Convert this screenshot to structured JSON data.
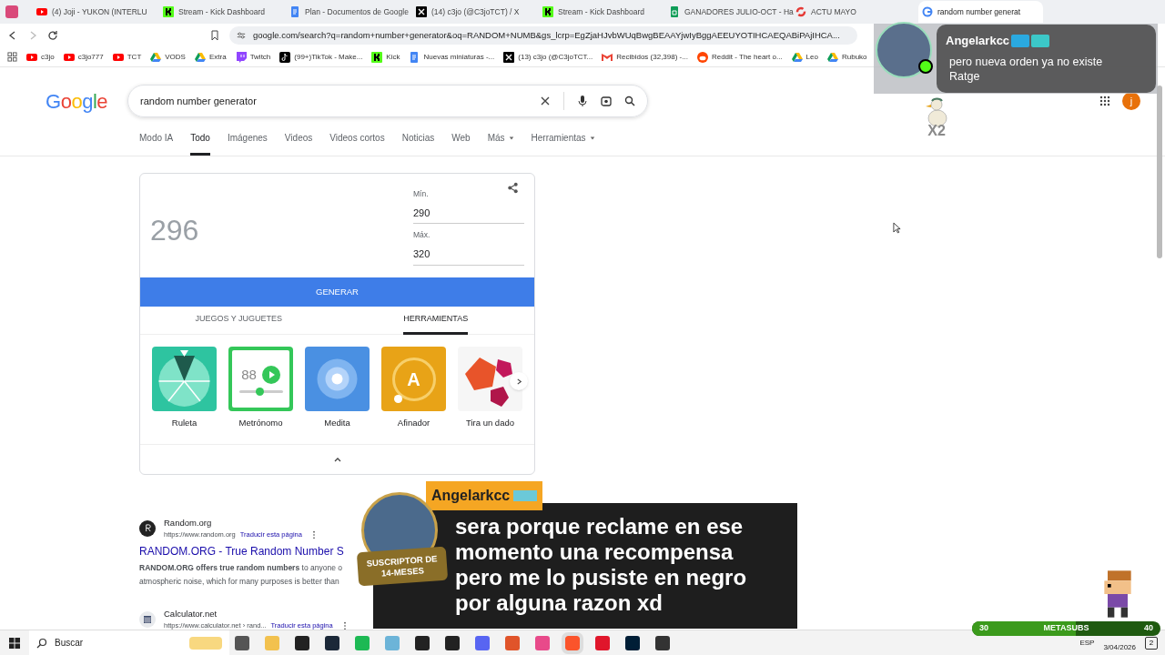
{
  "browser": {
    "tabs": [
      {
        "label": "(4) Joji - YUKON (INTERLU",
        "kind": "youtube",
        "selected": false
      },
      {
        "label": "Stream - Kick Dashboard",
        "kind": "kick",
        "selected": false
      },
      {
        "label": "Plan - Documentos de Google",
        "kind": "docs",
        "selected": false
      },
      {
        "label": "(14) c3jo (@C3joTCT) / X",
        "kind": "x",
        "selected": false
      },
      {
        "label": "Stream - Kick Dashboard",
        "kind": "kick",
        "selected": false
      },
      {
        "label": "GANADORES JULIO-OCT - Ha",
        "kind": "sheets",
        "selected": false
      },
      {
        "label": "ACTU MAYO",
        "kind": "ring",
        "selected": false
      },
      {
        "label": "random number generat",
        "kind": "google",
        "selected": true
      }
    ],
    "url": "google.com/search?q=random+number+generator&oq=RANDOM+NUMB&gs_lcrp=EgZjaHJvbWUqBwgBEAAYjwIyBggAEEUYOTIHCAEQABiPAjIHCA...",
    "bookmarks": [
      {
        "label": "c3jo",
        "kind": "youtube"
      },
      {
        "label": "c3jo777",
        "kind": "youtube"
      },
      {
        "label": "TCT",
        "kind": "youtube"
      },
      {
        "label": "VODS",
        "kind": "drive"
      },
      {
        "label": "Extra",
        "kind": "drive"
      },
      {
        "label": "Twitch",
        "kind": "twitch"
      },
      {
        "label": "(99+)TikTok - Make...",
        "kind": "tiktok"
      },
      {
        "label": "Kick",
        "kind": "kick"
      },
      {
        "label": "Nuevas miniaturas -...",
        "kind": "docs"
      },
      {
        "label": "(13) c3jo (@C3joTCT...",
        "kind": "x"
      },
      {
        "label": "Recibidos (32,398) -...",
        "kind": "gmail"
      },
      {
        "label": "Reddit - The heart o...",
        "kind": "reddit"
      },
      {
        "label": "Leo",
        "kind": "drive"
      },
      {
        "label": "Rubuko",
        "kind": "drive"
      }
    ]
  },
  "google": {
    "logo": "Google",
    "query": "random number generator",
    "avatar_letter": "j",
    "nav": [
      {
        "label": "Modo IA",
        "selected": false,
        "dropdown": false
      },
      {
        "label": "Todo",
        "selected": true,
        "dropdown": false
      },
      {
        "label": "Imágenes",
        "selected": false,
        "dropdown": false
      },
      {
        "label": "Videos",
        "selected": false,
        "dropdown": false
      },
      {
        "label": "Videos cortos",
        "selected": false,
        "dropdown": false
      },
      {
        "label": "Noticias",
        "selected": false,
        "dropdown": false
      },
      {
        "label": "Web",
        "selected": false,
        "dropdown": false
      },
      {
        "label": "Más",
        "selected": false,
        "dropdown": true
      },
      {
        "label": "Herramientas",
        "selected": false,
        "dropdown": true
      }
    ],
    "widget": {
      "result": "296",
      "min_label": "Mín.",
      "min_value": "290",
      "max_label": "Máx.",
      "max_value": "320",
      "button": "GENERAR",
      "tabs": [
        {
          "label": "JUEGOS Y JUGUETES",
          "selected": false
        },
        {
          "label": "HERRAMIENTAS",
          "selected": true
        }
      ],
      "tools": [
        {
          "label": "Ruleta",
          "kind": "wheel"
        },
        {
          "label": "Metrónomo",
          "kind": "metronome",
          "value": "88"
        },
        {
          "label": "Medita",
          "kind": "meditate"
        },
        {
          "label": "Afinador",
          "kind": "tuner",
          "value": "A"
        },
        {
          "label": "Tira un dado",
          "kind": "dice"
        }
      ]
    },
    "results": [
      {
        "site": "Random.org",
        "url": "https://www.random.org",
        "translate": "Traducir esta página",
        "title": "RANDOM.ORG - True Random Number S",
        "snippet": "**RANDOM.ORG offers true random numbers** to anyone o",
        "snippet2": "atmospheric noise, which for many purposes is better than",
        "kind": "letter"
      },
      {
        "site": "Calculator.net",
        "url": "https://www.calculator.net › rand...",
        "translate": "Traducir esta página",
        "kind": "calculator"
      }
    ]
  },
  "stream_overlay": {
    "top_chat": {
      "user": "Angelarkcc",
      "message": "pero nueva orden ya no existe Ratge"
    },
    "duck_multiplier": "X2",
    "main_chat": {
      "user": "Angelarkcc",
      "badge": [
        "SUSCRIPTOR DE",
        "14-MESES"
      ],
      "message": "sera porque reclame en ese momento una recompensa pero me lo pusiste en negro por alguna razon xd"
    },
    "goal": {
      "start": "30",
      "label": "METASUBS",
      "end": "40",
      "level": 0.55
    }
  },
  "taskbar": {
    "search": "Buscar",
    "language": "ESP",
    "date": "3/04/2026",
    "notifications": "2"
  }
}
